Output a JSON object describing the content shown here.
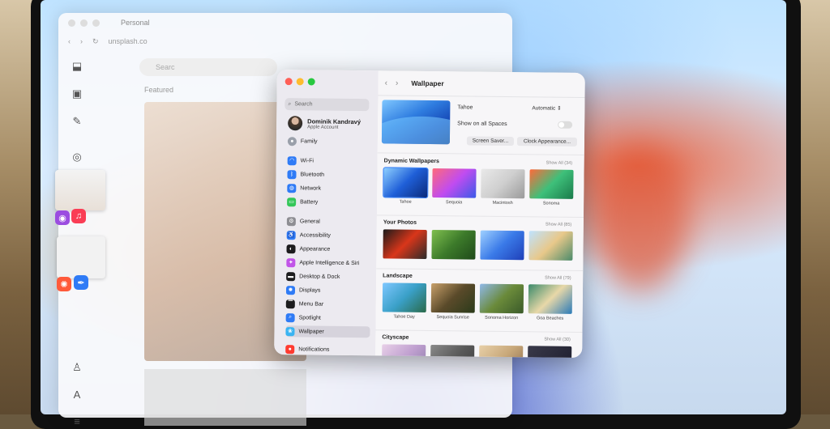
{
  "browser": {
    "tab_title": "Personal",
    "address": "unsplash.co",
    "search_placeholder": "Searc",
    "tab_featured": "Featured"
  },
  "settings": {
    "search_placeholder": "Search",
    "account": {
      "name": "Dominik Kandravý",
      "subtitle": "Apple Account"
    },
    "family_label": "Family",
    "sidebar": [
      {
        "label": "Wi-Fi",
        "icon": "wifi-icon",
        "color": "#2f7bf6"
      },
      {
        "label": "Bluetooth",
        "icon": "bluetooth-icon",
        "color": "#2f7bf6"
      },
      {
        "label": "Network",
        "icon": "globe-icon",
        "color": "#2f7bf6"
      },
      {
        "label": "Battery",
        "icon": "battery-icon",
        "color": "#34c759"
      },
      {
        "label": "General",
        "icon": "gear-icon",
        "color": "#8e8e93"
      },
      {
        "label": "Accessibility",
        "icon": "accessibility-icon",
        "color": "#2f7bf6"
      },
      {
        "label": "Appearance",
        "icon": "appearance-icon",
        "color": "#1c1c1e"
      },
      {
        "label": "Apple Intelligence & Siri",
        "icon": "siri-icon",
        "color": "#c155e8"
      },
      {
        "label": "Desktop & Dock",
        "icon": "dock-icon",
        "color": "#1c1c1e"
      },
      {
        "label": "Displays",
        "icon": "display-icon",
        "color": "#2f7bf6"
      },
      {
        "label": "Menu Bar",
        "icon": "menubar-icon",
        "color": "#1c1c1e"
      },
      {
        "label": "Spotlight",
        "icon": "spotlight-icon",
        "color": "#2f7bf6"
      },
      {
        "label": "Wallpaper",
        "icon": "wallpaper-icon",
        "color": "#3ab4f2"
      },
      {
        "label": "Notifications",
        "icon": "bell-icon",
        "color": "#ff3b30"
      }
    ],
    "selected": "Wallpaper",
    "main": {
      "title": "Wallpaper",
      "current_name": "Tahoe",
      "appearance_value": "Automatic",
      "show_all_spaces_label": "Show on all Spaces",
      "screen_saver_btn": "Screen Saver...",
      "clock_btn": "Clock Appearance...",
      "sections": [
        {
          "title": "Dynamic Wallpapers",
          "show_all": "Show All (34)",
          "tiles": [
            {
              "label": "Tahoe",
              "colors": [
                "#8fd0ff",
                "#1f5fd8",
                "#0b2a7a"
              ]
            },
            {
              "label": "Sequoia",
              "colors": [
                "#ff6a7a",
                "#c04cf0",
                "#3a5ae8"
              ]
            },
            {
              "label": "Macintosh",
              "colors": [
                "#e9e9e9",
                "#cfcfcf",
                "#9a9a9a"
              ]
            },
            {
              "label": "Sonoma",
              "colors": [
                "#ff6a3a",
                "#3ec07a",
                "#1a7a4a"
              ]
            }
          ]
        },
        {
          "title": "Your Photos",
          "show_all": "Show All (85)",
          "tiles": [
            {
              "label": "",
              "colors": [
                "#1a1a1a",
                "#d9361a",
                "#2a2a2a"
              ]
            },
            {
              "label": "",
              "colors": [
                "#7fbf4f",
                "#3c7a2a",
                "#1f4a1a"
              ]
            },
            {
              "label": "",
              "colors": [
                "#9fd0ff",
                "#3a7ae8",
                "#1f3fb8"
              ]
            },
            {
              "label": "",
              "colors": [
                "#bfe3ff",
                "#e8c88a",
                "#4a8a6a"
              ]
            }
          ]
        },
        {
          "title": "Landscape",
          "show_all": "Show All (79)",
          "tiles": [
            {
              "label": "Tahoe Day",
              "colors": [
                "#7fc7ff",
                "#3aa0c8",
                "#2a6a4a"
              ]
            },
            {
              "label": "Sequoia Sunrise",
              "colors": [
                "#c8a06a",
                "#5a4a2a",
                "#2a3a1a"
              ]
            },
            {
              "label": "Sonoma Horizon",
              "colors": [
                "#8fb8e8",
                "#6a8a3a",
                "#3a5a2a"
              ]
            },
            {
              "label": "Goa Beaches",
              "colors": [
                "#3a8a6a",
                "#e8d8a8",
                "#2a7ab8"
              ]
            }
          ]
        },
        {
          "title": "Cityscape",
          "show_all": "Show All (30)",
          "tiles": [
            {
              "label": "",
              "colors": [
                "#e8d0e8",
                "#c0a0d0",
                "#8a7aa8"
              ]
            },
            {
              "label": "",
              "colors": [
                "#8a8a8a",
                "#5a5a5a",
                "#3a3a3a"
              ]
            },
            {
              "label": "",
              "colors": [
                "#e8d0a8",
                "#c8a87a",
                "#8a6a4a"
              ]
            },
            {
              "label": "",
              "colors": [
                "#3a3a4a",
                "#2a2a3a",
                "#1a1a2a"
              ]
            }
          ]
        }
      ]
    }
  }
}
